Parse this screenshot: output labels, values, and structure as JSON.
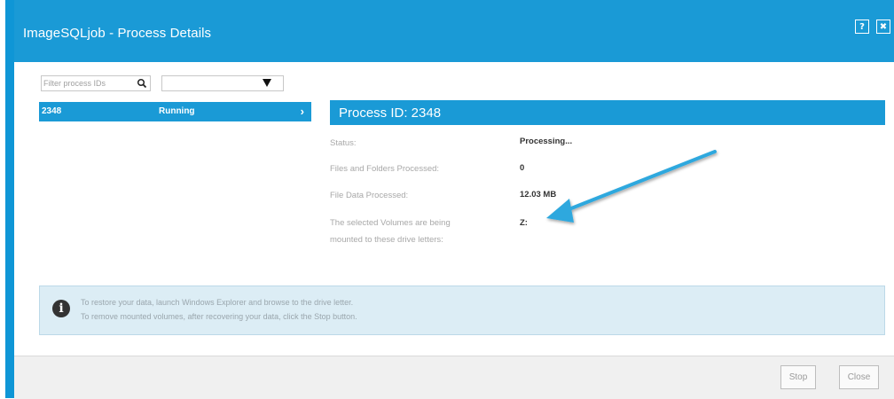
{
  "window": {
    "title": "ImageSQLjob - Process Details",
    "help_label": "?",
    "close_label": "✖"
  },
  "filter": {
    "placeholder": "Filter process IDs"
  },
  "dropdown": {
    "selected": ""
  },
  "processes": [
    {
      "id": "2348",
      "status": "Running",
      "chevron": "›"
    }
  ],
  "detail": {
    "header": "Process ID: 2348",
    "fields": [
      {
        "label": "Status:",
        "value": "Processing..."
      },
      {
        "label": "Files and Folders Processed:",
        "value": "0"
      },
      {
        "label": "File Data Processed:",
        "value": "12.03 MB"
      },
      {
        "label_line1": "The selected Volumes are being",
        "label_line2": "mounted to these drive letters:",
        "value": "Z:"
      }
    ]
  },
  "info": {
    "icon": "info-icon",
    "line1": "To restore your data, launch Windows Explorer and browse to the drive letter.",
    "line2": "To remove mounted volumes, after recovering your data, click the Stop button."
  },
  "footer": {
    "stop_label": "Stop",
    "close_label": "Close"
  },
  "colors": {
    "accent": "#1a9ad6",
    "annotation_arrow": "#2ea8de"
  }
}
